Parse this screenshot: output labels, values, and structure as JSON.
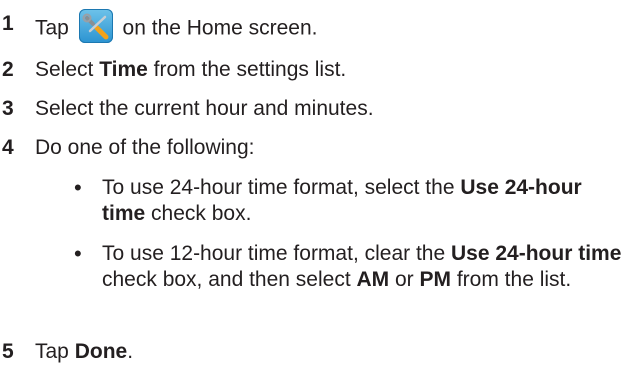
{
  "steps": [
    {
      "num": "1",
      "before": "Tap",
      "icon": "settings-tools-icon",
      "after": "on the Home screen."
    },
    {
      "num": "2",
      "pre": "Select ",
      "bold": "Time",
      "post": " from the settings list."
    },
    {
      "num": "3",
      "text": "Select the current hour and minutes."
    },
    {
      "num": "4",
      "text": "Do one of the following:"
    },
    {
      "num": "5",
      "pre": "Tap ",
      "bold": "Done",
      "post": "."
    }
  ],
  "bullets": [
    {
      "marker": "•",
      "p1": "To use 24-hour time format, select the ",
      "b1": "Use 24-hour time",
      "p2": " check box."
    },
    {
      "marker": "•",
      "p1": "To use 12-hour time format, clear the ",
      "b1": "Use 24-hour time",
      "p2": " check box, and then select ",
      "b2": "AM",
      "p3": " or ",
      "b3": "PM",
      "p4": " from the list."
    }
  ]
}
